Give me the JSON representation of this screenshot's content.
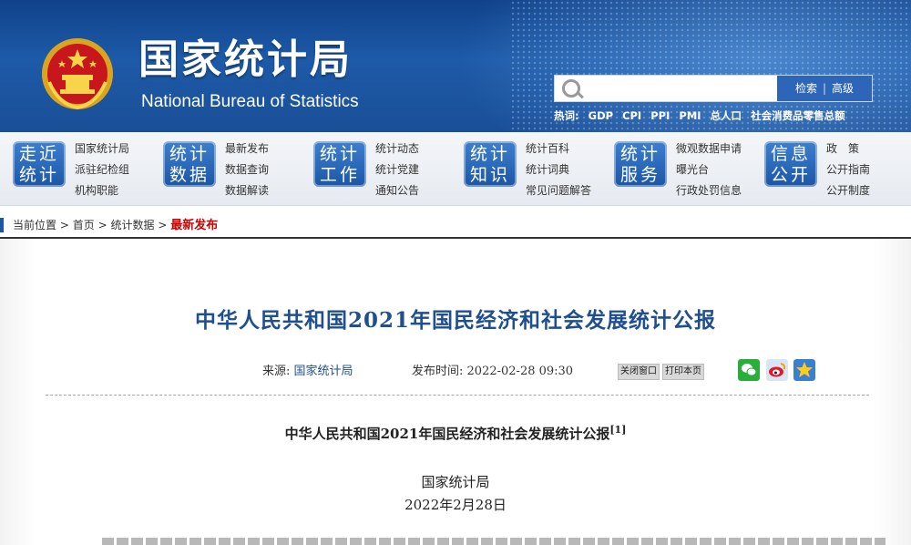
{
  "header": {
    "title_cn": "国家统计局",
    "title_en": "National Bureau of Statistics",
    "search": {
      "placeholder": "",
      "button_search": "检索",
      "button_advanced": "高级"
    },
    "hotwords_label": "热词:",
    "hotwords": [
      "GDP",
      "CPI",
      "PPI",
      "PMI",
      "总人口",
      "社会消费品零售总额"
    ],
    "colors": {
      "header_blue": "#1d5aa8",
      "button_blue": "#2d66b8"
    }
  },
  "nav": [
    {
      "badge_top": "走近",
      "badge_bottom": "统计",
      "links": [
        "国家统计局",
        "派驻纪检组",
        "机构职能"
      ]
    },
    {
      "badge_top": "统计",
      "badge_bottom": "数据",
      "links": [
        "最新发布",
        "数据查询",
        "数据解读"
      ]
    },
    {
      "badge_top": "统计",
      "badge_bottom": "工作",
      "links": [
        "统计动态",
        "统计党建",
        "通知公告"
      ]
    },
    {
      "badge_top": "统计",
      "badge_bottom": "知识",
      "links": [
        "统计百科",
        "统计词典",
        "常见问题解答"
      ]
    },
    {
      "badge_top": "统计",
      "badge_bottom": "服务",
      "links": [
        "微观数据申请",
        "曝光台",
        "行政处罚信息"
      ]
    },
    {
      "badge_top": "信息",
      "badge_bottom": "公开",
      "links": [
        "政　策",
        "公开指南",
        "公开制度"
      ]
    }
  ],
  "breadcrumb": {
    "label": "当前位置",
    "items": [
      "首页",
      "统计数据"
    ],
    "current": "最新发布",
    "sep": ">"
  },
  "article": {
    "title": "中华人民共和国2021年国民经济和社会发展统计公报",
    "source_label": "来源:",
    "source_value": "国家统计局",
    "time_label": "发布时间:",
    "time_value": "2022-02-28 09:30",
    "close_label": "关闭窗口",
    "print_label": "打印本页",
    "share_icons": [
      "wechat-icon",
      "weibo-icon",
      "favorite-icon"
    ],
    "doc_title": "中华人民共和国2021年国民经济和社会发展统计公报",
    "doc_footnote": "[1]",
    "doc_org": "国家统计局",
    "doc_date": "2022年2月28日"
  }
}
